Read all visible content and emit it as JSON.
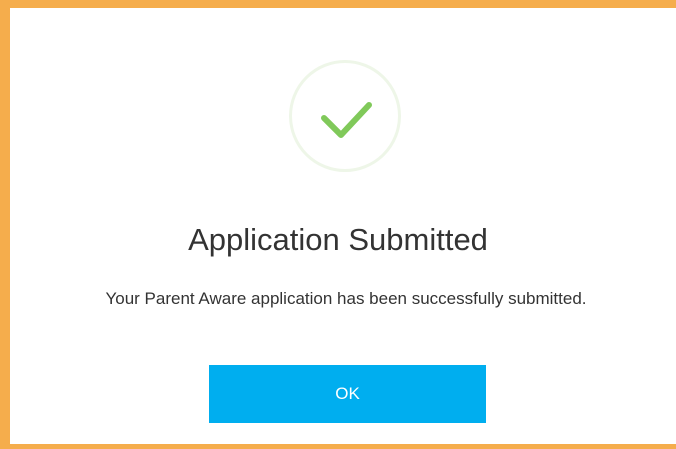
{
  "dialog": {
    "icon": "checkmark-icon",
    "title": "Application Submitted",
    "message": "Your Parent Aware application has been successfully submitted.",
    "ok_label": "OK"
  },
  "colors": {
    "accent_border": "#f5ad4c",
    "button": "#00aeef",
    "check": "#80c95a",
    "circle": "#eef6e8",
    "text": "#333333"
  }
}
